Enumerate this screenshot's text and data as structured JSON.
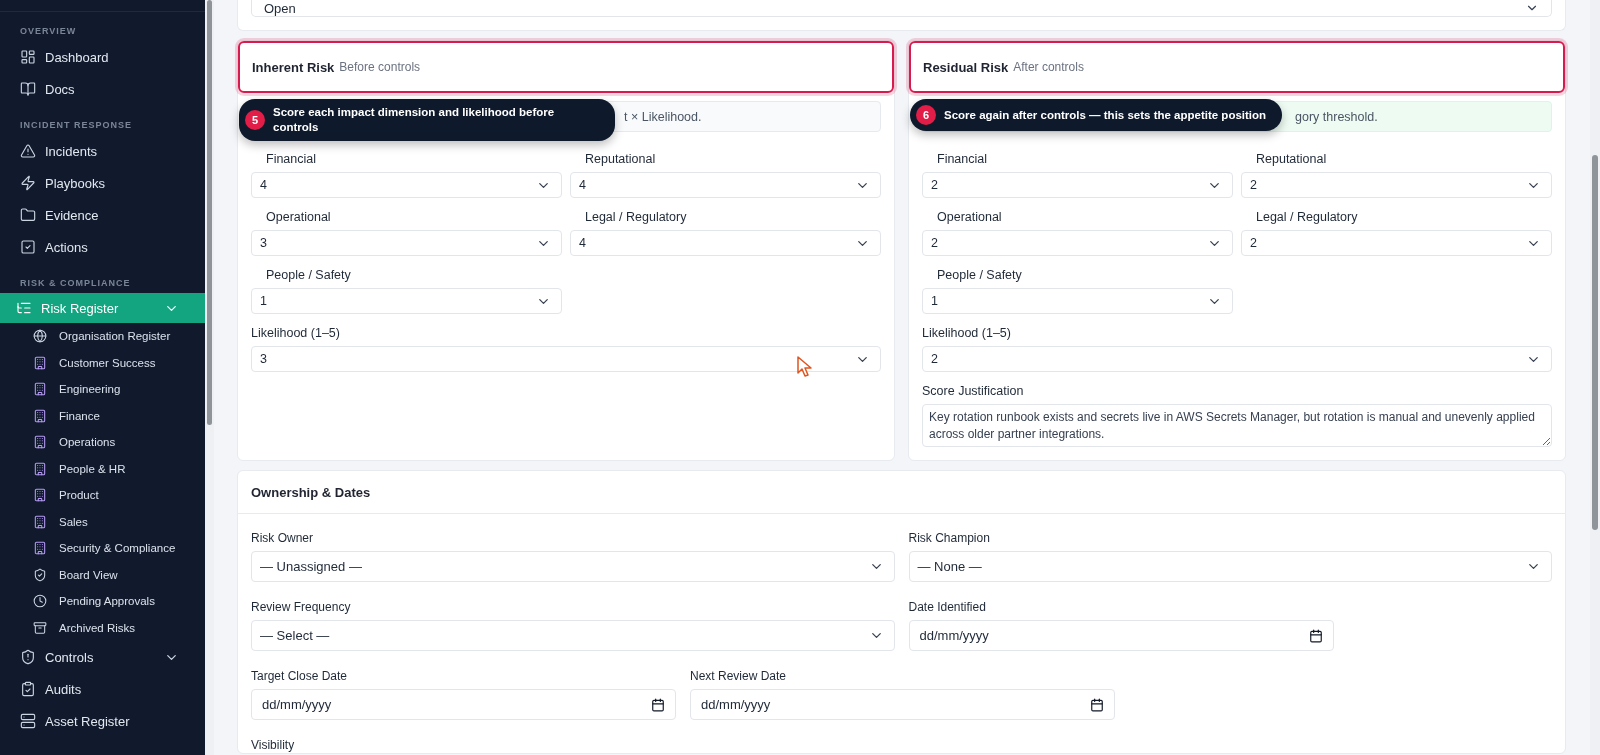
{
  "status_field": {
    "value": "Open"
  },
  "sidebar": {
    "sections": [
      {
        "title": "OVERVIEW",
        "items": [
          {
            "label": "Dashboard",
            "selected": false
          },
          {
            "label": "Docs",
            "selected": false
          }
        ]
      },
      {
        "title": "INCIDENT RESPONSE",
        "items": [
          {
            "label": "Incidents",
            "selected": false
          },
          {
            "label": "Playbooks",
            "selected": false
          },
          {
            "label": "Evidence",
            "selected": false
          },
          {
            "label": "Actions",
            "selected": false
          }
        ]
      },
      {
        "title": "RISK & COMPLIANCE",
        "items": [
          {
            "label": "Risk Register",
            "selected": true,
            "expanded": true,
            "children": [
              {
                "label": "Organisation Register",
                "selected": false
              },
              {
                "label": "Customer Success",
                "selected": false
              },
              {
                "label": "Engineering",
                "selected": false
              },
              {
                "label": "Finance",
                "selected": false
              },
              {
                "label": "Operations",
                "selected": false
              },
              {
                "label": "People & HR",
                "selected": false
              },
              {
                "label": "Product",
                "selected": false
              },
              {
                "label": "Sales",
                "selected": false
              },
              {
                "label": "Security & Compliance",
                "selected": false
              },
              {
                "label": "Board View",
                "selected": false
              },
              {
                "label": "Pending Approvals",
                "selected": false
              },
              {
                "label": "Archived Risks",
                "selected": false
              }
            ]
          },
          {
            "label": "Controls",
            "selected": false,
            "expanded": false
          },
          {
            "label": "Audits",
            "selected": false
          },
          {
            "label": "Asset Register",
            "selected": false
          }
        ]
      }
    ]
  },
  "inherent_risk": {
    "title": "Inherent Risk",
    "subtitle": "Before controls",
    "highlighted": true,
    "info": {
      "kind": "neutral",
      "text": "t × Likelihood."
    },
    "tip": {
      "number": "5",
      "text": "Score each impact dimension and likelihood **before controls**"
    },
    "impacts": [
      {
        "label": "Financial",
        "value": "4"
      },
      {
        "label": "Reputational",
        "value": "4"
      },
      {
        "label": "Operational",
        "value": "3"
      },
      {
        "label": "Legal / Regulatory",
        "value": "4"
      },
      {
        "label": "People / Safety",
        "value": "1"
      }
    ],
    "likelihood": {
      "label": "Likelihood (1–5)",
      "value": "3"
    }
  },
  "residual_risk": {
    "title": "Residual Risk",
    "subtitle": "After controls",
    "highlighted": true,
    "info": {
      "kind": "success",
      "text": "gory threshold."
    },
    "tip": {
      "number": "6",
      "text": "Score again **after controls** — this sets the appetite position"
    },
    "impacts": [
      {
        "label": "Financial",
        "value": "2"
      },
      {
        "label": "Reputational",
        "value": "2"
      },
      {
        "label": "Operational",
        "value": "2"
      },
      {
        "label": "Legal / Regulatory",
        "value": "2"
      },
      {
        "label": "People / Safety",
        "value": "1"
      }
    ],
    "likelihood": {
      "label": "Likelihood (1–5)",
      "value": "2"
    },
    "justification": {
      "label": "Score Justification",
      "value": "Key rotation runbook exists and secrets live in AWS Secrets Manager, but rotation is manual and unevenly applied across older partner integrations."
    }
  },
  "ownership": {
    "title": "Ownership & Dates",
    "rows": [
      [
        {
          "label": "Risk Owner",
          "kind": "select",
          "value": "— Unassigned —"
        },
        {
          "label": "Risk Champion",
          "kind": "select",
          "value": "— None —"
        }
      ],
      [
        {
          "label": "Review Frequency",
          "kind": "select",
          "value": "— Select —"
        },
        {
          "label": "Date Identified",
          "kind": "date",
          "placeholder": "dd/mm/yyyy"
        }
      ],
      [
        {
          "label": "Target Close Date",
          "kind": "date",
          "placeholder": "dd/mm/yyyy"
        },
        {
          "label": "Next Review Date",
          "kind": "date",
          "placeholder": "dd/mm/yyyy"
        }
      ]
    ],
    "partial_field": {
      "label": "Visibility"
    }
  }
}
